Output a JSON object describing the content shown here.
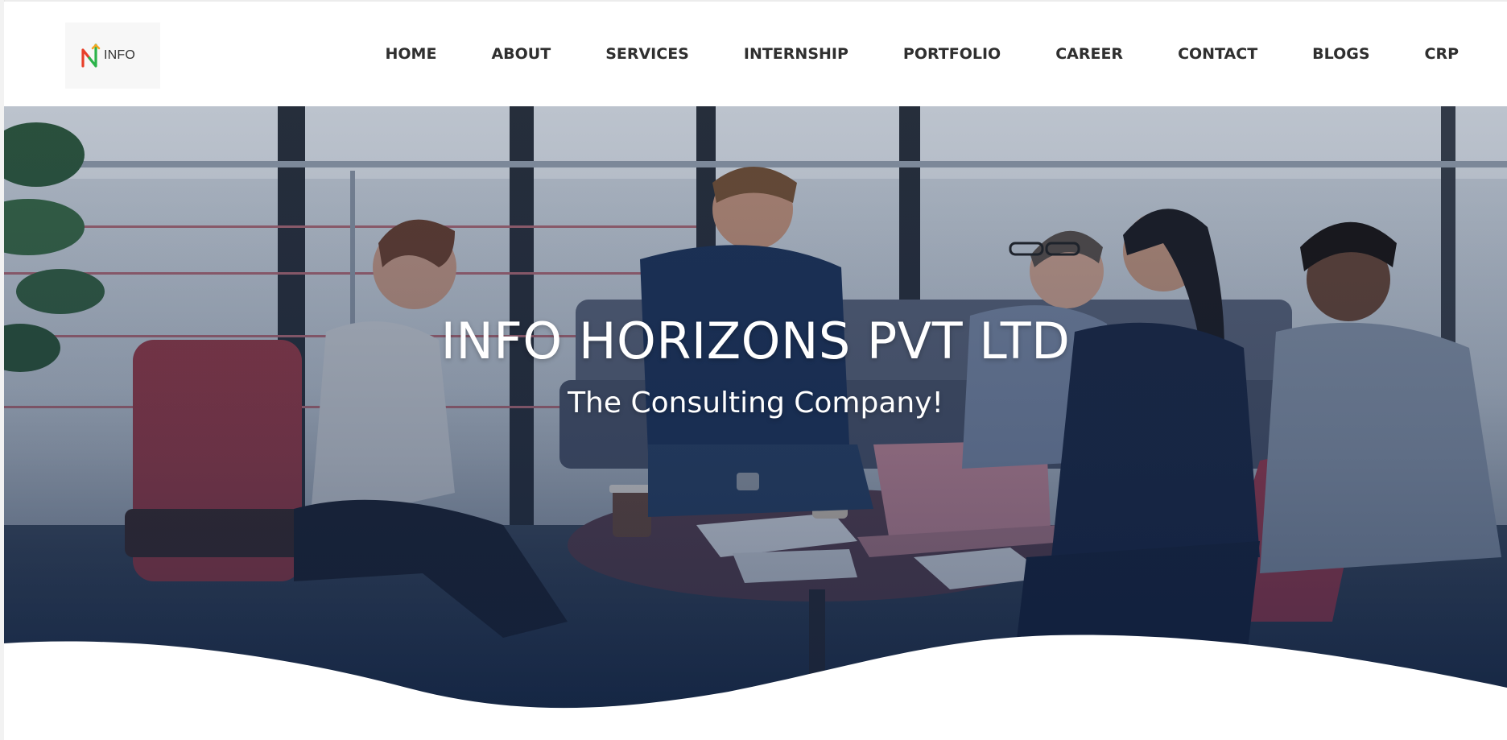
{
  "header": {
    "logo": {
      "text": "INFO",
      "icon": "info-horizons-logo-icon"
    },
    "nav": [
      {
        "label": "HOME"
      },
      {
        "label": "ABOUT"
      },
      {
        "label": "SERVICES"
      },
      {
        "label": "INTERNSHIP"
      },
      {
        "label": "PORTFOLIO"
      },
      {
        "label": "CAREER"
      },
      {
        "label": "CONTACT"
      },
      {
        "label": "BLOGS"
      },
      {
        "label": "CRP"
      }
    ]
  },
  "hero": {
    "title": "INFO HORIZONS PVT LTD",
    "subtitle": "The Consulting Company!",
    "image": "team-meeting-photo"
  },
  "colors": {
    "nav_text": "#2f2f2f",
    "hero_text": "#ffffff",
    "overlay": "#14284a",
    "logo_green": "#2bb34a",
    "logo_red": "#e8402a",
    "logo_orange": "#f5a623"
  }
}
